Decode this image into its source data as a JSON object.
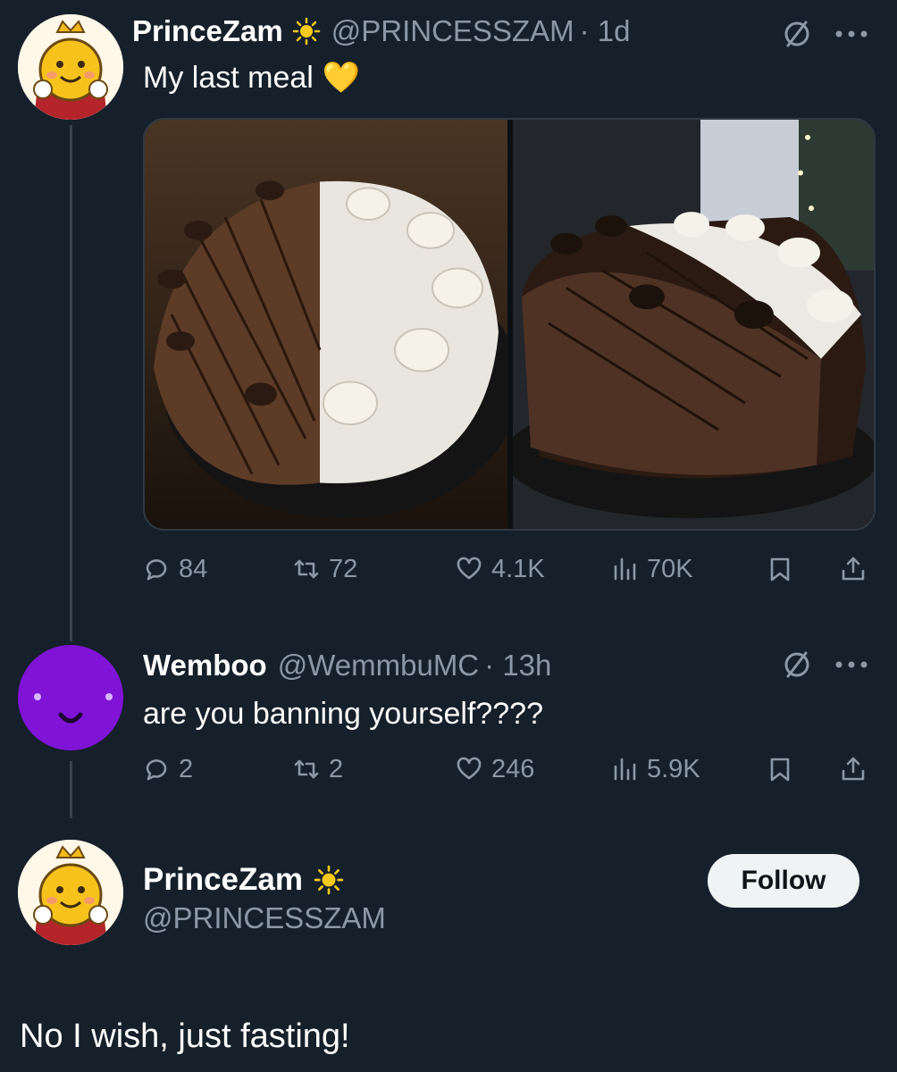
{
  "tweet1": {
    "name": "PrinceZam",
    "handle": "@PRINCESSZAM",
    "time": "· 1d",
    "text": "My last meal",
    "emoji": "💛",
    "stats": {
      "replies": "84",
      "retweets": "72",
      "likes": "4.1K",
      "views": "70K"
    }
  },
  "reply": {
    "name": "Wemboo",
    "handle": "@WemmbuMC",
    "time": "· 13h",
    "text": "are you banning yourself????",
    "stats": {
      "replies": "2",
      "retweets": "2",
      "likes": "246",
      "views": "5.9K"
    }
  },
  "main": {
    "name": "PrinceZam",
    "handle": "@PRINCESSZAM",
    "follow_label": "Follow",
    "text": "No I wish, just fasting!"
  },
  "icons": {
    "verified": "sun-badge-icon",
    "grok": "slashed-circle-icon",
    "more": "more-dots-icon",
    "reply": "reply-bubble-icon",
    "retweet": "retweet-icon",
    "like": "heart-icon",
    "views": "views-bars-icon",
    "bookmark": "bookmark-icon",
    "share": "share-icon"
  },
  "colors": {
    "background": "#15202b",
    "secondary_text": "#8b98a5",
    "avatar_purple": "#7f13d6",
    "follow_bg": "#eff3f4"
  }
}
